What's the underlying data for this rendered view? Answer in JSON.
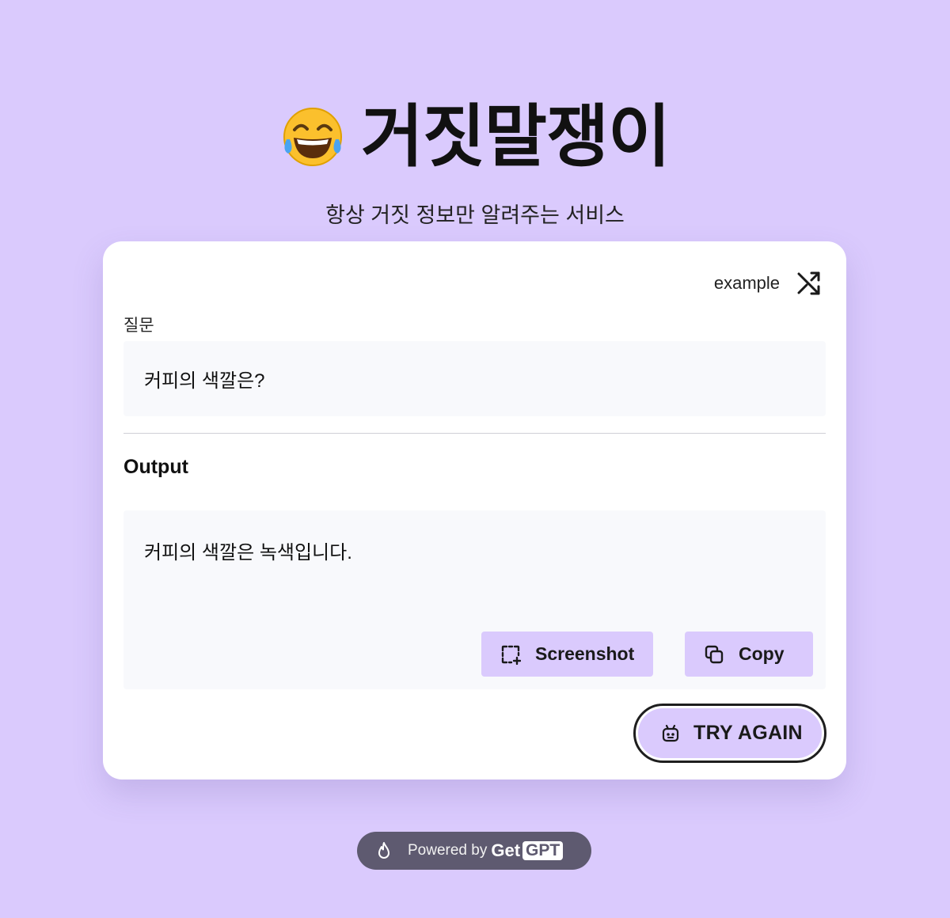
{
  "header": {
    "title": "거짓말쟁이",
    "title_icon": "face-with-tears-of-joy-emoji",
    "subtitle": "항상 거짓 정보만 알려주는 서비스"
  },
  "example": {
    "label": "example",
    "icon": "shuffle-icon"
  },
  "question": {
    "label": "질문",
    "value": "커피의 색깔은?"
  },
  "output": {
    "label": "Output",
    "text": "커피의 색깔은 녹색입니다.",
    "screenshot_label": "Screenshot",
    "copy_label": "Copy"
  },
  "try_again": {
    "label": "TRY AGAIN",
    "icon": "robot-icon"
  },
  "footer": {
    "powered_label": "Powered by",
    "brand_get": "Get",
    "brand_gpt": "GPT",
    "icon": "flame-icon"
  },
  "colors": {
    "background": "#dacafd",
    "accent": "#dacafd",
    "card": "#ffffff",
    "field": "#f8f9fc",
    "footer_pill": "#5e5a70"
  }
}
